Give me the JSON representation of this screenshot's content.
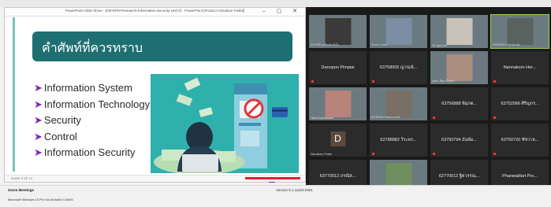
{
  "ppt": {
    "window_title": "PowerPoint Slide Show - [KM-EPM-Research-Information-Security-Unit-2] - PowerPoint [Product Activation Failed]",
    "window_controls": "– ▢ ✕",
    "slide_title": "คำศัพท์ที่ควรทราบ",
    "bullets": [
      "Information System",
      "Information Technology",
      "Security",
      "Control",
      "Information Security"
    ],
    "bullet_glyph": "➤",
    "status_text": "SLIDE 3 OF 12",
    "accent": "#1e6f72",
    "illustration": {
      "background": "#2fb0ad",
      "icons": [
        "money-bills",
        "atm-machine",
        "prohibition-sign",
        "credit-card",
        "hacker-with-laptop",
        "pile-of-cash"
      ]
    }
  },
  "zoom": {
    "tiles": [
      {
        "name": "",
        "caption": "62/1005 นุจรินทร์ คำใจ",
        "video": true,
        "kind": "video-woman"
      },
      {
        "name": "",
        "caption": "วิภาดา วรรณ",
        "video": true,
        "kind": "video-woman-blue"
      },
      {
        "name": "",
        "caption": "Vy ngoc Lan",
        "video": true,
        "kind": "video-woman-light"
      },
      {
        "name": "",
        "caption": "62/5/2022 ดวงกมล ชุ่ม",
        "video": true,
        "kind": "video-man",
        "selected": true
      },
      {
        "name": "Danupon Pimpiai",
        "caption": "",
        "video": false
      },
      {
        "name": "63758005 ญาณนั...",
        "caption": "",
        "video": false
      },
      {
        "name": "",
        "caption": "ภูษิตา มีสุข Sunee ...",
        "video": true,
        "kind": "photo-woman"
      },
      {
        "name": "Nannakorn Her...",
        "caption": "",
        "video": false
      },
      {
        "name": "",
        "caption": "Tane Kanchanasra",
        "video": true,
        "kind": "photo-flowers"
      },
      {
        "name": "",
        "caption": "62750030 ลักษณาภรณ์",
        "video": true,
        "kind": "photo-couple"
      },
      {
        "name": "63756888 พิมุกต...",
        "caption": "",
        "video": false
      },
      {
        "name": "63752966 ศิริญกร...",
        "caption": "",
        "video": false
      },
      {
        "name": "",
        "caption": "Darunkorn Pratet",
        "video": false,
        "avatar": "D"
      },
      {
        "name": "62788882 วีระพร...",
        "caption": "",
        "video": false
      },
      {
        "name": "63750794 ธันพ์ม...",
        "caption": "",
        "video": false
      },
      {
        "name": "63750720 ชัชวาล...",
        "caption": "",
        "video": false
      },
      {
        "name": "63770012 ภรณิส...",
        "caption": "",
        "video": false
      },
      {
        "name": "",
        "caption": "Pimpanan Pay",
        "video": true,
        "kind": "photo-garden"
      },
      {
        "name": "62770012 ฐิตวรรณ...",
        "caption": "",
        "video": false
      },
      {
        "name": "Phanwaillart Pro...",
        "caption": "",
        "video": false
      }
    ]
  },
  "bottom": {
    "app_name": "Zoom Meetings",
    "version": "Version 5.1.11102.0301",
    "os": "Microsoft Windows 10 Pro 64-bit build 9.18000"
  }
}
